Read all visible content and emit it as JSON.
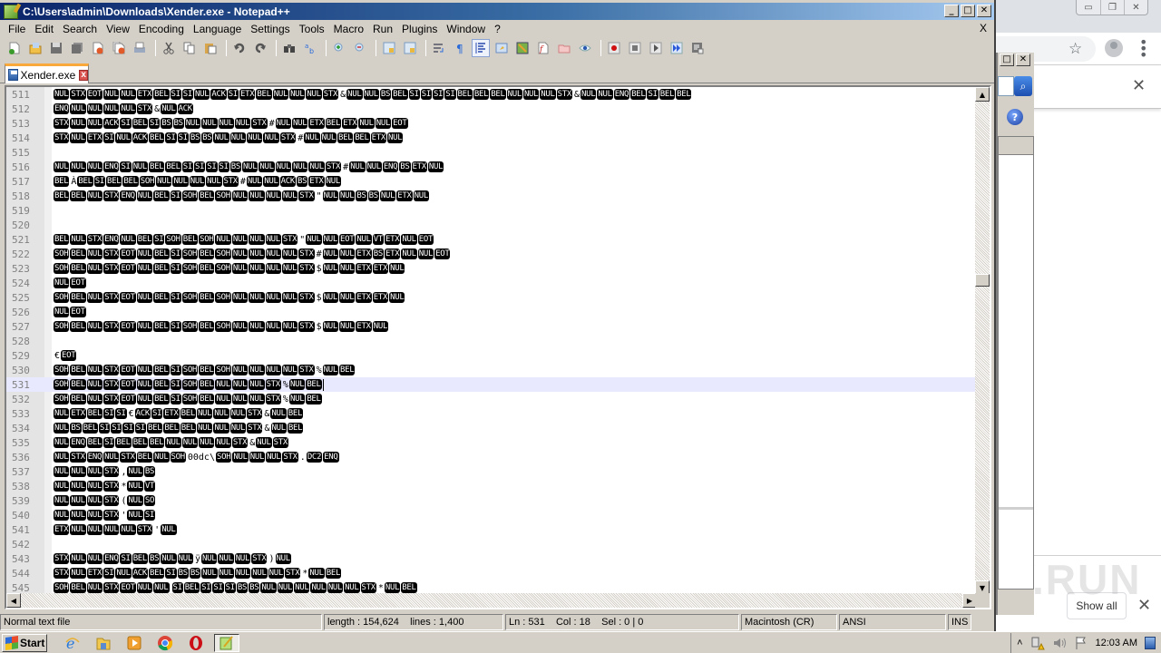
{
  "window": {
    "title": "C:\\Users\\admin\\Downloads\\Xender.exe - Notepad++",
    "minimize": "_",
    "maximize": "□",
    "close": "✕"
  },
  "menu": {
    "items": [
      "File",
      "Edit",
      "Search",
      "View",
      "Encoding",
      "Language",
      "Settings",
      "Tools",
      "Macro",
      "Run",
      "Plugins",
      "Window",
      "?"
    ],
    "close_doc": "X"
  },
  "toolbar": {
    "buttons": [
      "new-file",
      "open-file",
      "save",
      "save-all",
      "close",
      "close-all",
      "print",
      "cut",
      "copy",
      "paste",
      "undo",
      "redo",
      "find",
      "replace",
      "zoom-in",
      "zoom-out",
      "sync-vertical",
      "sync-horizontal",
      "word-wrap",
      "show-all-chars",
      "indent-guide",
      "user-defined-language",
      "document-map",
      "function-list",
      "folder-as-workspace",
      "monitoring",
      "record-macro",
      "stop-recording",
      "playback-macro",
      "run-macro-multiple",
      "save-macro"
    ]
  },
  "tabs": [
    {
      "label": "Xender.exe",
      "active": true,
      "close": "x"
    }
  ],
  "editor": {
    "current_line": 531,
    "lines": [
      {
        "n": "511",
        "tokens": [
          "NUL",
          "STX",
          "EOT",
          "NUL",
          "NUL",
          "ETX",
          "BEL",
          "SI",
          "SI",
          "NUL",
          "ACK",
          "SI",
          "ETX",
          "BEL",
          "NUL",
          "NUL",
          "NUL",
          "STX",
          "&",
          "NUL",
          "NUL",
          "BS",
          "BEL",
          "SI",
          "SI",
          "SI",
          "SI",
          "BEL",
          "BEL",
          "BEL",
          "NUL",
          "NUL",
          "NUL",
          "STX",
          "&",
          "NUL",
          "NUL",
          "ENQ",
          "BEL",
          "SI",
          "BEL",
          "BEL"
        ]
      },
      {
        "n": "512",
        "tokens": [
          "ENQ",
          "NUL",
          "NUL",
          "NUL",
          "NUL",
          "STX",
          "&",
          "NUL",
          "ACK"
        ]
      },
      {
        "n": "513",
        "tokens": [
          "STX",
          "NUL",
          "NUL",
          "ACK",
          "SI",
          "BEL",
          "SI",
          "BS",
          "BS",
          "NUL",
          "NUL",
          "NUL",
          "NUL",
          "STX",
          "#",
          "NUL",
          "NUL",
          "ETX",
          "BEL",
          "ETX",
          "NUL",
          "NUL",
          "EOT"
        ]
      },
      {
        "n": "514",
        "tokens": [
          "STX",
          "NUL",
          "ETX",
          "SI",
          "NUL",
          "ACK",
          "BEL",
          "SI",
          "SI",
          "BS",
          "BS",
          "NUL",
          "NUL",
          "NUL",
          "NUL",
          "STX",
          "#",
          "NUL",
          "NUL",
          "BEL",
          "BEL",
          "ETX",
          "NUL"
        ]
      },
      {
        "n": "515",
        "tokens": []
      },
      {
        "n": "516",
        "tokens": [
          "NUL",
          "NUL",
          "NUL",
          "ENQ",
          "SI",
          "NUL",
          "BEL",
          "BEL",
          "SI",
          "SI",
          "SI",
          "SI",
          "BS",
          "NUL",
          "NUL",
          "NUL",
          "NUL",
          "NUL",
          "STX",
          "#",
          "NUL",
          "NUL",
          "ENQ",
          "BS",
          "ETX",
          "NUL"
        ]
      },
      {
        "n": "517",
        "tokens": [
          "BEL",
          "À",
          "BEL",
          "SI",
          "BEL",
          "BEL",
          "SOH",
          "NUL",
          "NUL",
          "NUL",
          "NUL",
          "STX",
          "#",
          "NUL",
          "NUL",
          "ACK",
          "BS",
          "ETX",
          "NUL"
        ]
      },
      {
        "n": "518",
        "tokens": [
          "BEL",
          "BEL",
          "NUL",
          "STX",
          "ENQ",
          "NUL",
          "BEL",
          "SI",
          "SOH",
          "BEL",
          "SOH",
          "NUL",
          "NUL",
          "NUL",
          "NUL",
          "STX",
          "\"",
          "NUL",
          "NUL",
          "BS",
          "BS",
          "NUL",
          "ETX",
          "NUL"
        ]
      },
      {
        "n": "519",
        "tokens": []
      },
      {
        "n": "520",
        "tokens": []
      },
      {
        "n": "521",
        "tokens": [
          "BEL",
          "NUL",
          "STX",
          "ENQ",
          "NUL",
          "BEL",
          "SI",
          "SOH",
          "BEL",
          "SOH",
          "NUL",
          "NUL",
          "NUL",
          "NUL",
          "STX",
          "\"",
          "NUL",
          "NUL",
          "EOT",
          "NUL",
          "VT",
          "ETX",
          "NUL",
          "EOT"
        ]
      },
      {
        "n": "522",
        "tokens": [
          "SOH",
          "BEL",
          "NUL",
          "STX",
          "EOT",
          "NUL",
          "BEL",
          "SI",
          "SOH",
          "BEL",
          "SOH",
          "NUL",
          "NUL",
          "NUL",
          "NUL",
          "STX",
          "#",
          "NUL",
          "NUL",
          "ETX",
          "BS",
          "ETX",
          "NUL",
          "NUL",
          "EOT"
        ]
      },
      {
        "n": "523",
        "tokens": [
          "SOH",
          "BEL",
          "NUL",
          "STX",
          "EOT",
          "NUL",
          "BEL",
          "SI",
          "SOH",
          "BEL",
          "SOH",
          "NUL",
          "NUL",
          "NUL",
          "NUL",
          "STX",
          "$",
          "NUL",
          "NUL",
          "ETX",
          "ETX",
          "NUL"
        ]
      },
      {
        "n": "524",
        "tokens": [
          "NUL",
          "EOT"
        ]
      },
      {
        "n": "525",
        "tokens": [
          "SOH",
          "BEL",
          "NUL",
          "STX",
          "EOT",
          "NUL",
          "BEL",
          "SI",
          "SOH",
          "BEL",
          "SOH",
          "NUL",
          "NUL",
          "NUL",
          "NUL",
          "STX",
          "$",
          "NUL",
          "NUL",
          "ETX",
          "ETX",
          "NUL"
        ]
      },
      {
        "n": "526",
        "tokens": [
          "NUL",
          "EOT"
        ]
      },
      {
        "n": "527",
        "tokens": [
          "SOH",
          "BEL",
          "NUL",
          "STX",
          "EOT",
          "NUL",
          "BEL",
          "SI",
          "SOH",
          "BEL",
          "SOH",
          "NUL",
          "NUL",
          "NUL",
          "NUL",
          "STX",
          "$",
          "NUL",
          "NUL",
          "ETX",
          "NUL"
        ]
      },
      {
        "n": "528",
        "tokens": []
      },
      {
        "n": "529",
        "tokens": [
          "€",
          "EOT"
        ]
      },
      {
        "n": "530",
        "tokens": [
          "SOH",
          "BEL",
          "NUL",
          "STX",
          "EOT",
          "NUL",
          "BEL",
          "SI",
          "SOH",
          "BEL",
          "SOH",
          "NUL",
          "NUL",
          "NUL",
          "NUL",
          "STX",
          "%",
          "NUL",
          "BEL"
        ]
      },
      {
        "n": "531",
        "tokens": [
          "SOH",
          "BEL",
          "NUL",
          "STX",
          "EOT",
          "NUL",
          "BEL",
          "SI",
          "SOH",
          "BEL",
          "NUL",
          "NUL",
          "NUL",
          "STX",
          "%",
          "NUL",
          "BEL"
        ]
      },
      {
        "n": "532",
        "tokens": [
          "SOH",
          "BEL",
          "NUL",
          "STX",
          "EOT",
          "NUL",
          "BEL",
          "SI",
          "SOH",
          "BEL",
          "NUL",
          "NUL",
          "NUL",
          "STX",
          "%",
          "NUL",
          "BEL"
        ]
      },
      {
        "n": "533",
        "tokens": [
          "NUL",
          "ETX",
          "BEL",
          "SI",
          "SI",
          "€",
          "ACK",
          "SI",
          "ETX",
          "BEL",
          "NUL",
          "NUL",
          "NUL",
          "STX",
          "&",
          "NUL",
          "BEL"
        ]
      },
      {
        "n": "534",
        "tokens": [
          "NUL",
          "BS",
          "BEL",
          "SI",
          "SI",
          "SI",
          "SI",
          "BEL",
          "BEL",
          "BEL",
          "NUL",
          "NUL",
          "NUL",
          "STX",
          "&",
          "NUL",
          "BEL"
        ]
      },
      {
        "n": "535",
        "tokens": [
          "NUL",
          "ENQ",
          "BEL",
          "SI",
          "BEL",
          "BEL",
          "BEL",
          "NUL",
          "NUL",
          "NUL",
          "NUL",
          "STX",
          "&",
          "NUL",
          "STX"
        ]
      },
      {
        "n": "536",
        "tokens": [
          "NUL",
          "STX",
          "ENQ",
          "NUL",
          "STX",
          "BEL",
          "NUL",
          "SOH",
          "00dc\\",
          "SOH",
          "NUL",
          "NUL",
          "NUL",
          "STX",
          ".",
          "DC2",
          "ENQ"
        ]
      },
      {
        "n": "537",
        "tokens": [
          "NUL",
          "NUL",
          "NUL",
          "STX",
          ",",
          "NUL",
          "BS"
        ]
      },
      {
        "n": "538",
        "tokens": [
          "NUL",
          "NUL",
          "NUL",
          "STX",
          "*",
          "NUL",
          "VT"
        ]
      },
      {
        "n": "539",
        "tokens": [
          "NUL",
          "NUL",
          "NUL",
          "STX",
          "(",
          "NUL",
          "SO"
        ]
      },
      {
        "n": "540",
        "tokens": [
          "NUL",
          "NUL",
          "NUL",
          "STX",
          "'",
          "NUL",
          "SI"
        ]
      },
      {
        "n": "541",
        "tokens": [
          "ETX",
          "NUL",
          "NUL",
          "NUL",
          "NUL",
          "STX",
          "'",
          "NUL"
        ]
      },
      {
        "n": "542",
        "tokens": []
      },
      {
        "n": "543",
        "tokens": [
          "STX",
          "NUL",
          "NUL",
          "ENQ",
          "SI",
          "BEL",
          "BS",
          "NUL",
          "NUL",
          "ÿ",
          "NUL",
          "NUL",
          "NUL",
          "STX",
          ")",
          "NUL"
        ]
      },
      {
        "n": "544",
        "tokens": [
          "STX",
          "NUL",
          "ETX",
          "SI",
          "NUL",
          "ACK",
          "BEL",
          "SI",
          "BS",
          "BS",
          "NUL",
          "NUL",
          "NUL",
          "NUL",
          "NUL",
          "STX",
          "*",
          "NUL",
          "BEL"
        ]
      },
      {
        "n": "545",
        "tokens": [
          "SOH",
          "BEL",
          "NUL",
          "STX",
          "EOT",
          "NUL",
          "NUL",
          " ",
          "SI",
          "BEL",
          "SI",
          "SI",
          "SI",
          "BS",
          "BS",
          "NUL",
          "NUL",
          "NUL",
          "NUL",
          "NUL",
          "NUL",
          "STX",
          "*",
          "NUL",
          "BEL"
        ]
      }
    ]
  },
  "statusbar": {
    "file_type": "Normal text file",
    "length_lines": "length : 154,624    lines : 1,400",
    "position": "Ln : 531    Col : 18    Sel : 0 | 0",
    "eol": "Macintosh (CR)",
    "encoding": "ANSI",
    "mode": "INS"
  },
  "browser": {
    "download_show_all": "Show all",
    "close": "✕",
    "star": "☆",
    "menu": "⋮",
    "watermark": "ANY.RUN"
  },
  "sidewin": {
    "maximize": "□",
    "close": "✕",
    "help": "?"
  },
  "taskbar": {
    "start_label": "Start",
    "apps": [
      "internet-explorer",
      "file-explorer",
      "media-player",
      "chrome",
      "opera",
      "notepad-plus-plus"
    ],
    "clock": "12:03 AM",
    "tray_expand": "˄"
  }
}
